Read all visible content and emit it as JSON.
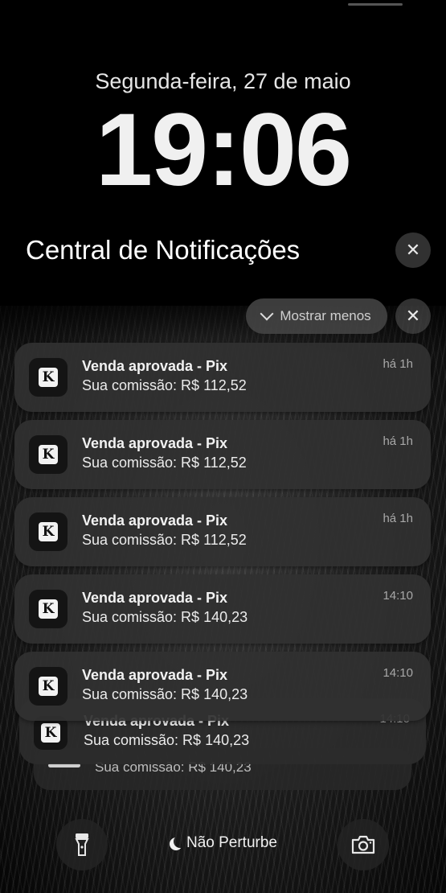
{
  "lock_screen": {
    "date": "Segunda-feira, 27 de maio",
    "time": "19:06"
  },
  "notification_center": {
    "title": "Central de Notificações",
    "clear_all_icon": "close-icon",
    "group": {
      "show_less_label": "Mostrar menos",
      "clear_icon": "close-icon"
    },
    "notifications": [
      {
        "app_icon_letter": "K",
        "title": "Venda aprovada - Pix",
        "body": "Sua comissão: R$ 112,52",
        "time": "há 1h"
      },
      {
        "app_icon_letter": "K",
        "title": "Venda aprovada - Pix",
        "body": "Sua comissão: R$ 112,52",
        "time": "há 1h"
      },
      {
        "app_icon_letter": "K",
        "title": "Venda aprovada - Pix",
        "body": "Sua comissão: R$ 112,52",
        "time": "há 1h"
      },
      {
        "app_icon_letter": "K",
        "title": "Venda aprovada - Pix",
        "body": "Sua comissão: R$ 140,23",
        "time": "14:10"
      },
      {
        "app_icon_letter": "K",
        "title": "Venda aprovada - Pix",
        "body": "Sua comissão: R$ 140,23",
        "time": "14:10"
      },
      {
        "app_icon_letter": "K",
        "title": "Venda aprovada - Pix",
        "body": "Sua comissão: R$ 140,23",
        "time": "14:10"
      },
      {
        "body": "Sua comissão: R$ 140,23"
      }
    ]
  },
  "bottom_bar": {
    "flashlight_icon": "flashlight-icon",
    "focus_label": "Não Perturbe",
    "focus_icon": "moon-icon",
    "camera_icon": "camera-icon"
  }
}
